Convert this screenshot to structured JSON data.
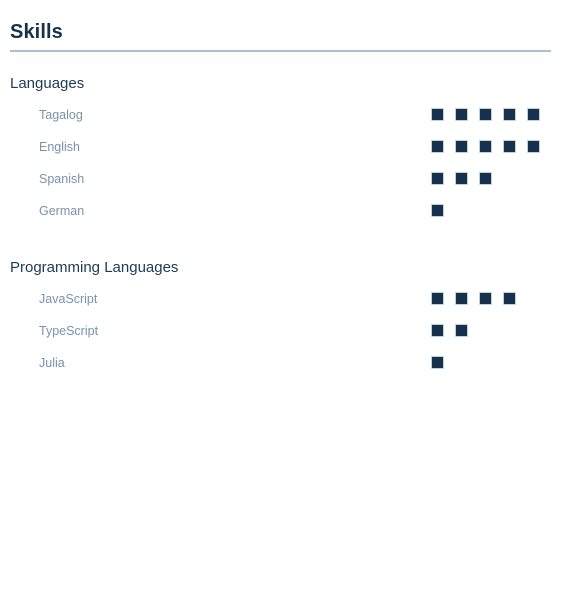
{
  "document": {
    "title": "Skills",
    "accent_rule_color": "#a9c0d6",
    "title_color": "#17314a",
    "label_color": "#7b93ac",
    "pip_fill_color": "#17314a",
    "pip_border_color": "#bcd0e2",
    "max_rating": 5
  },
  "sections": [
    {
      "heading": "Languages",
      "skills": [
        {
          "name": "Tagalog",
          "rating": 5
        },
        {
          "name": "English",
          "rating": 5
        },
        {
          "name": "Spanish",
          "rating": 3
        },
        {
          "name": "German",
          "rating": 1
        }
      ]
    },
    {
      "heading": "Programming Languages",
      "skills": [
        {
          "name": "JavaScript",
          "rating": 4
        },
        {
          "name": "TypeScript",
          "rating": 2
        },
        {
          "name": "Julia",
          "rating": 1
        }
      ]
    }
  ]
}
